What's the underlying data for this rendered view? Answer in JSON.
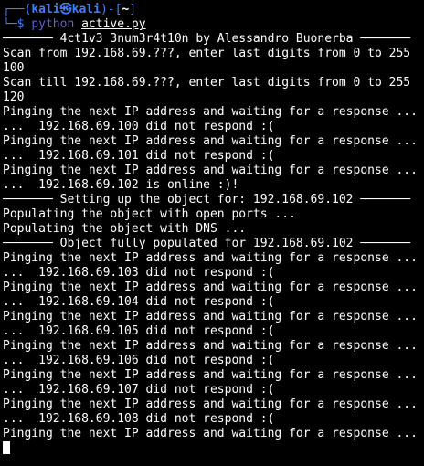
{
  "prompt": {
    "frame_top": "┌──(",
    "user": "kali㉿kali",
    "close_user": ")-[",
    "dir": "~",
    "close_dir": "]",
    "frame_bottom": "└─$ ",
    "command": "python",
    "argument": "active.py"
  },
  "output_lines": [
    "─────── 4ct1v3 3num3r4t10n by Alessandro Buonerba ───────",
    "Scan from 192.168.69.???, enter last digits from 0 to 255",
    "100",
    "Scan till 192.168.69.???, enter last digits from 0 to 255",
    "120",
    "Pinging the next IP address and waiting for a response ...",
    "...  192.168.69.100 did not respond :(",
    "Pinging the next IP address and waiting for a response ...",
    "...  192.168.69.101 did not respond :(",
    "Pinging the next IP address and waiting for a response ...",
    "...  192.168.69.102 is online :)!",
    "─────── Setting up the object for: 192.168.69.102 ───────",
    "Populating the object with open ports ...",
    "Populating the object with DNS ...",
    "─────── Object fully populated for 192.168.69.102 ───────",
    "Pinging the next IP address and waiting for a response ...",
    "...  192.168.69.103 did not respond :(",
    "Pinging the next IP address and waiting for a response ...",
    "...  192.168.69.104 did not respond :(",
    "Pinging the next IP address and waiting for a response ...",
    "...  192.168.69.105 did not respond :(",
    "Pinging the next IP address and waiting for a response ...",
    "...  192.168.69.106 did not respond :(",
    "Pinging the next IP address and waiting for a response ...",
    "...  192.168.69.107 did not respond :(",
    "Pinging the next IP address and waiting for a response ...",
    "...  192.168.69.108 did not respond :(",
    "Pinging the next IP address and waiting for a response ..."
  ],
  "colors": {
    "background": "#000000",
    "foreground": "#ffffff",
    "prompt_accent": "#3f7fff",
    "command": "#5f5fe0"
  }
}
